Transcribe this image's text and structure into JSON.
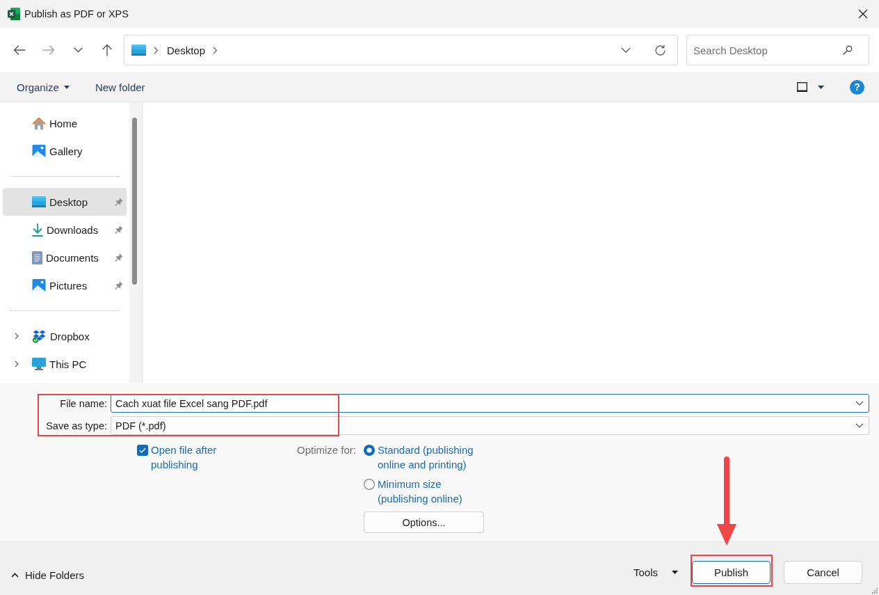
{
  "window": {
    "title": "Publish as PDF or XPS"
  },
  "address_bar": {
    "path": [
      "Desktop"
    ]
  },
  "search": {
    "placeholder": "Search Desktop"
  },
  "toolbar": {
    "organize": "Organize",
    "new_folder": "New folder",
    "help": "?"
  },
  "sidebar": {
    "groups": [
      {
        "items": [
          {
            "label": "Home",
            "selected": false,
            "pinned": false
          },
          {
            "label": "Gallery",
            "selected": false,
            "pinned": false
          }
        ]
      },
      {
        "items": [
          {
            "label": "Desktop",
            "selected": true,
            "pinned": true
          },
          {
            "label": "Downloads",
            "selected": false,
            "pinned": true
          },
          {
            "label": "Documents",
            "selected": false,
            "pinned": true
          },
          {
            "label": "Pictures",
            "selected": false,
            "pinned": true
          }
        ]
      },
      {
        "items": [
          {
            "label": "Dropbox",
            "selected": false,
            "pinned": false,
            "expanded": false
          },
          {
            "label": "This PC",
            "selected": false,
            "pinned": false,
            "expanded": false
          }
        ]
      }
    ]
  },
  "file_name": {
    "label": "File name:",
    "value": "Cach xuat file Excel sang PDF.pdf",
    "focused": true
  },
  "save_as_type": {
    "label": "Save as type:",
    "value": "PDF (*.pdf)"
  },
  "open_after_publishing": {
    "label": "Open file after publishing",
    "checked": true
  },
  "optimize_for": {
    "label": "Optimize for:",
    "options": [
      {
        "label": "Standard (publishing online and printing)",
        "selected": true
      },
      {
        "label": "Minimum size (publishing online)",
        "selected": false
      }
    ]
  },
  "options_button": "Options...",
  "footer": {
    "hide_folders": "Hide Folders",
    "tools": "Tools",
    "buttons": [
      {
        "label": "Publish",
        "default": true
      },
      {
        "label": "Cancel",
        "default": false
      }
    ]
  }
}
